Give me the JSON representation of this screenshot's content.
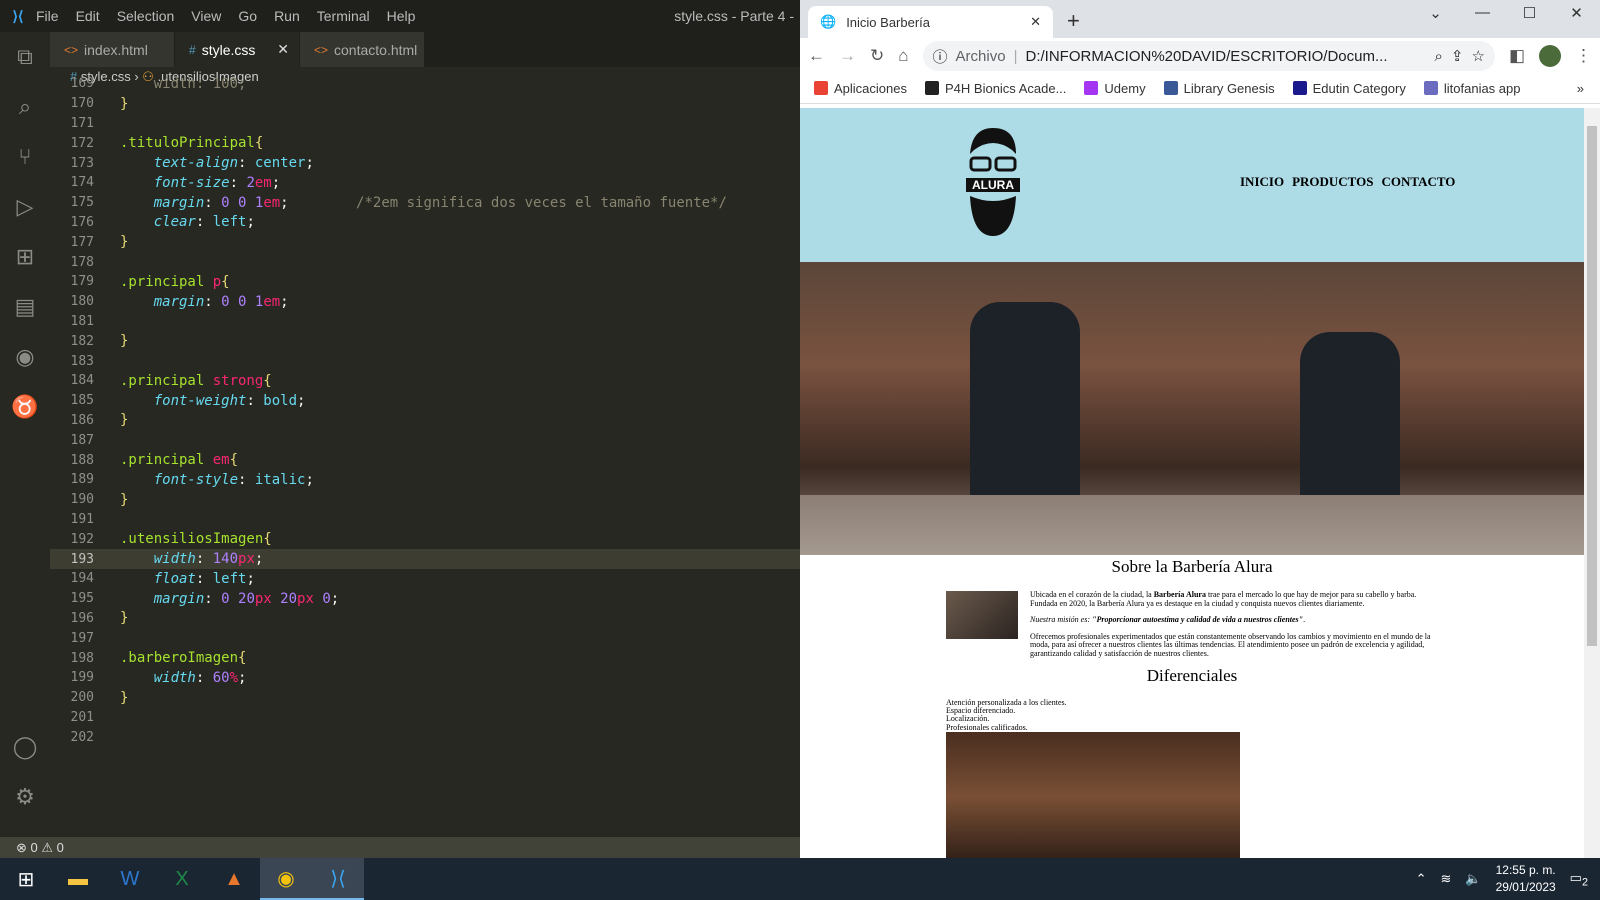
{
  "vscode": {
    "menu": [
      "File",
      "Edit",
      "Selection",
      "View",
      "Go",
      "Run",
      "Terminal",
      "Help"
    ],
    "window_title": "style.css - Parte 4 -",
    "tabs": [
      {
        "label": "index.html",
        "icon": "html-icon"
      },
      {
        "label": "style.css",
        "icon": "css-icon",
        "close": "✕"
      },
      {
        "label": "contacto.html",
        "icon": "html-icon"
      }
    ],
    "breadcrumb": {
      "file": "style.css",
      "symbol": ".utensiliosImagen"
    },
    "status": {
      "errors": "0",
      "warnings": "0"
    },
    "lines": [
      {
        "n": "169",
        "t": [
          [
            "    width: 100;",
            "cm"
          ]
        ]
      },
      {
        "n": "170",
        "t": [
          [
            "}",
            "br"
          ]
        ]
      },
      {
        "n": "171",
        "t": []
      },
      {
        "n": "172",
        "t": [
          [
            ".tituloPrincipal",
            "sel"
          ],
          [
            "{",
            "br"
          ]
        ]
      },
      {
        "n": "173",
        "t": [
          [
            "    ",
            "p"
          ],
          [
            "text-align",
            "prop"
          ],
          [
            ": ",
            "p"
          ],
          [
            "center",
            "val"
          ],
          [
            ";",
            "p"
          ]
        ]
      },
      {
        "n": "174",
        "t": [
          [
            "    ",
            "p"
          ],
          [
            "font-size",
            "prop"
          ],
          [
            ": ",
            "p"
          ],
          [
            "2",
            "num"
          ],
          [
            "em",
            "unit"
          ],
          [
            ";",
            "p"
          ]
        ]
      },
      {
        "n": "175",
        "t": [
          [
            "    ",
            "p"
          ],
          [
            "margin",
            "prop"
          ],
          [
            ": ",
            "p"
          ],
          [
            "0 0 1",
            "num"
          ],
          [
            "em",
            "unit"
          ],
          [
            ";",
            "p"
          ],
          [
            "        /*2em significa dos veces el tamaño fuente*/",
            "cm"
          ]
        ]
      },
      {
        "n": "176",
        "t": [
          [
            "    ",
            "p"
          ],
          [
            "clear",
            "prop"
          ],
          [
            ": ",
            "p"
          ],
          [
            "left",
            "val"
          ],
          [
            ";",
            "p"
          ]
        ]
      },
      {
        "n": "177",
        "t": [
          [
            "}",
            "br"
          ]
        ]
      },
      {
        "n": "178",
        "t": []
      },
      {
        "n": "179",
        "t": [
          [
            ".principal ",
            "sel"
          ],
          [
            "p",
            "tag"
          ],
          [
            "{",
            "br"
          ]
        ]
      },
      {
        "n": "180",
        "t": [
          [
            "    ",
            "p"
          ],
          [
            "margin",
            "prop"
          ],
          [
            ": ",
            "p"
          ],
          [
            "0 0 1",
            "num"
          ],
          [
            "em",
            "unit"
          ],
          [
            ";",
            "p"
          ]
        ]
      },
      {
        "n": "181",
        "t": []
      },
      {
        "n": "182",
        "t": [
          [
            "}",
            "br"
          ]
        ]
      },
      {
        "n": "183",
        "t": []
      },
      {
        "n": "184",
        "t": [
          [
            ".principal ",
            "sel"
          ],
          [
            "strong",
            "tag"
          ],
          [
            "{",
            "br"
          ]
        ]
      },
      {
        "n": "185",
        "t": [
          [
            "    ",
            "p"
          ],
          [
            "font-weight",
            "prop"
          ],
          [
            ": ",
            "p"
          ],
          [
            "bold",
            "val"
          ],
          [
            ";",
            "p"
          ]
        ]
      },
      {
        "n": "186",
        "t": [
          [
            "}",
            "br"
          ]
        ]
      },
      {
        "n": "187",
        "t": []
      },
      {
        "n": "188",
        "t": [
          [
            ".principal ",
            "sel"
          ],
          [
            "em",
            "tag"
          ],
          [
            "{",
            "br"
          ]
        ]
      },
      {
        "n": "189",
        "t": [
          [
            "    ",
            "p"
          ],
          [
            "font-style",
            "prop"
          ],
          [
            ": ",
            "p"
          ],
          [
            "italic",
            "val"
          ],
          [
            ";",
            "p"
          ]
        ]
      },
      {
        "n": "190",
        "t": [
          [
            "}",
            "br"
          ]
        ]
      },
      {
        "n": "191",
        "t": []
      },
      {
        "n": "192",
        "t": [
          [
            ".utensiliosImagen",
            "sel"
          ],
          [
            "{",
            "br"
          ]
        ]
      },
      {
        "n": "193",
        "cur": true,
        "t": [
          [
            "    ",
            "p"
          ],
          [
            "width",
            "prop"
          ],
          [
            ": ",
            "p"
          ],
          [
            "140",
            "num"
          ],
          [
            "px",
            "unit"
          ],
          [
            ";",
            "p"
          ]
        ]
      },
      {
        "n": "194",
        "t": [
          [
            "    ",
            "p"
          ],
          [
            "float",
            "prop"
          ],
          [
            ": ",
            "p"
          ],
          [
            "left",
            "val"
          ],
          [
            ";",
            "p"
          ]
        ]
      },
      {
        "n": "195",
        "t": [
          [
            "    ",
            "p"
          ],
          [
            "margin",
            "prop"
          ],
          [
            ": ",
            "p"
          ],
          [
            "0 20",
            "num"
          ],
          [
            "px ",
            "unit"
          ],
          [
            "20",
            "num"
          ],
          [
            "px ",
            "unit"
          ],
          [
            "0",
            "num"
          ],
          [
            ";",
            "p"
          ]
        ]
      },
      {
        "n": "196",
        "t": [
          [
            "}",
            "br"
          ]
        ]
      },
      {
        "n": "197",
        "t": []
      },
      {
        "n": "198",
        "t": [
          [
            ".barberoImagen",
            "sel"
          ],
          [
            "{",
            "br"
          ]
        ]
      },
      {
        "n": "199",
        "t": [
          [
            "    ",
            "p"
          ],
          [
            "width",
            "prop"
          ],
          [
            ": ",
            "p"
          ],
          [
            "60",
            "num"
          ],
          [
            "%",
            "unit"
          ],
          [
            ";",
            "p"
          ]
        ]
      },
      {
        "n": "200",
        "t": [
          [
            "}",
            "br"
          ]
        ]
      },
      {
        "n": "201",
        "t": []
      },
      {
        "n": "202",
        "t": []
      }
    ]
  },
  "browser": {
    "tab_title": "Inicio Barbería",
    "address_prefix": "Archivo",
    "url": "D:/INFORMACION%20DAVID/ESCRITORIO/Docum...",
    "bookmarks": [
      {
        "label": "Aplicaciones",
        "color": "#ea4335"
      },
      {
        "label": "P4H Bionics Acade...",
        "color": "#222222"
      },
      {
        "label": "Udemy",
        "color": "#a435f0"
      },
      {
        "label": "Library Genesis",
        "color": "#3b5998"
      },
      {
        "label": "Edutin Category",
        "color": "#1a1a8c"
      },
      {
        "label": "litofanias app",
        "color": "#6b6bbf"
      }
    ],
    "more": "»"
  },
  "site": {
    "logo_text": "ALURA",
    "nav": [
      "INICIO",
      "PRODUCTOS",
      "CONTACTO"
    ],
    "header_color": "#addbe6",
    "about_title": "Sobre la Barbería Alura",
    "p1_a": "Ubicada en el corazón de la ciudad, la ",
    "p1_strong": "Barbería Alura",
    "p1_b": " trae para el mercado lo que hay de mejor para su cabello y barba. Fundada en 2020, la Barbería Alura ya es destaque en la ciudad y conquista nuevos clientes diariamente.",
    "p2_em": "Nuestra misión es: ",
    "p2_strong": "\"Proporcionar autoestima y calidad de vida a nuestros clientes\"",
    "p2_end": ".",
    "p3": "Ofrecemos profesionales experimentados que están constantemente observando los cambios y movimiento en el mundo de la moda, para así ofrecer a nuestros clientes las últimas tendencias. El atendimiento posee un padrón de excelencia y agilidad, garantizando calidad y satisfacción de nuestros clientes.",
    "dif_title": "Diferenciales",
    "dif_items": [
      "Atención personalizada a los clientes.",
      "Espacio diferenciado.",
      "Localización.",
      "Profesionales calificados."
    ]
  },
  "taskbar": {
    "time": "12:55 p. m.",
    "date": "29/01/2023",
    "notifications": "2"
  }
}
